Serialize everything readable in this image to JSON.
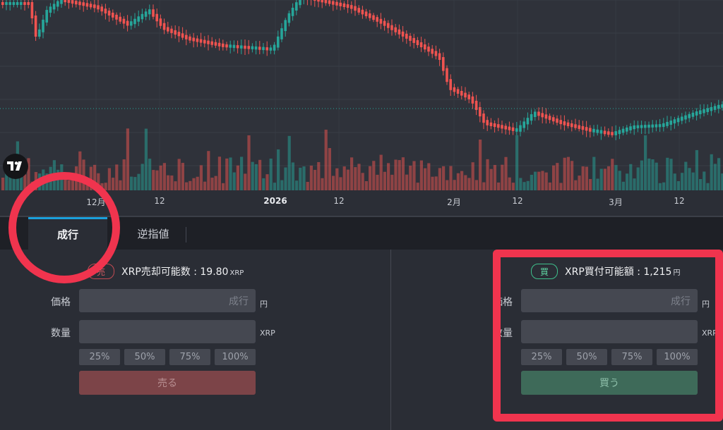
{
  "colors": {
    "up": "#26a69a",
    "down": "#ef5350",
    "accent": "#1aa0dc",
    "annotation": "#f0344e"
  },
  "chart": {
    "type": "candlestick",
    "time_axis": {
      "ticks": [
        {
          "label": "12月",
          "bold": false
        },
        {
          "label": "12",
          "bold": false
        },
        {
          "label": "2026",
          "bold": true
        },
        {
          "label": "12",
          "bold": false
        },
        {
          "label": "2月",
          "bold": false
        },
        {
          "label": "12",
          "bold": false
        },
        {
          "label": "3月",
          "bold": false
        },
        {
          "label": "12",
          "bold": false
        }
      ]
    },
    "logo_icon": "tradingview-logo-icon"
  },
  "tabs": [
    {
      "label": "成行",
      "active": true
    },
    {
      "label": "逆指値",
      "active": false
    }
  ],
  "sell": {
    "badge": "売",
    "available_label": "XRP売却可能数 : 19.80",
    "available_unit": "XRP",
    "price_label": "価格",
    "price_placeholder": "成行",
    "price_unit": "円",
    "qty_label": "数量",
    "qty_unit": "XRP",
    "percents": [
      "25%",
      "50%",
      "75%",
      "100%"
    ],
    "button": "売る"
  },
  "buy": {
    "badge": "買",
    "available_label": "XRP買付可能額 : 1,215",
    "available_unit": "円",
    "price_label": "価格",
    "price_placeholder": "成行",
    "price_unit": "円",
    "qty_label": "数量",
    "qty_unit": "XRP",
    "percents": [
      "25%",
      "50%",
      "75%",
      "100%"
    ],
    "button": "買う"
  }
}
